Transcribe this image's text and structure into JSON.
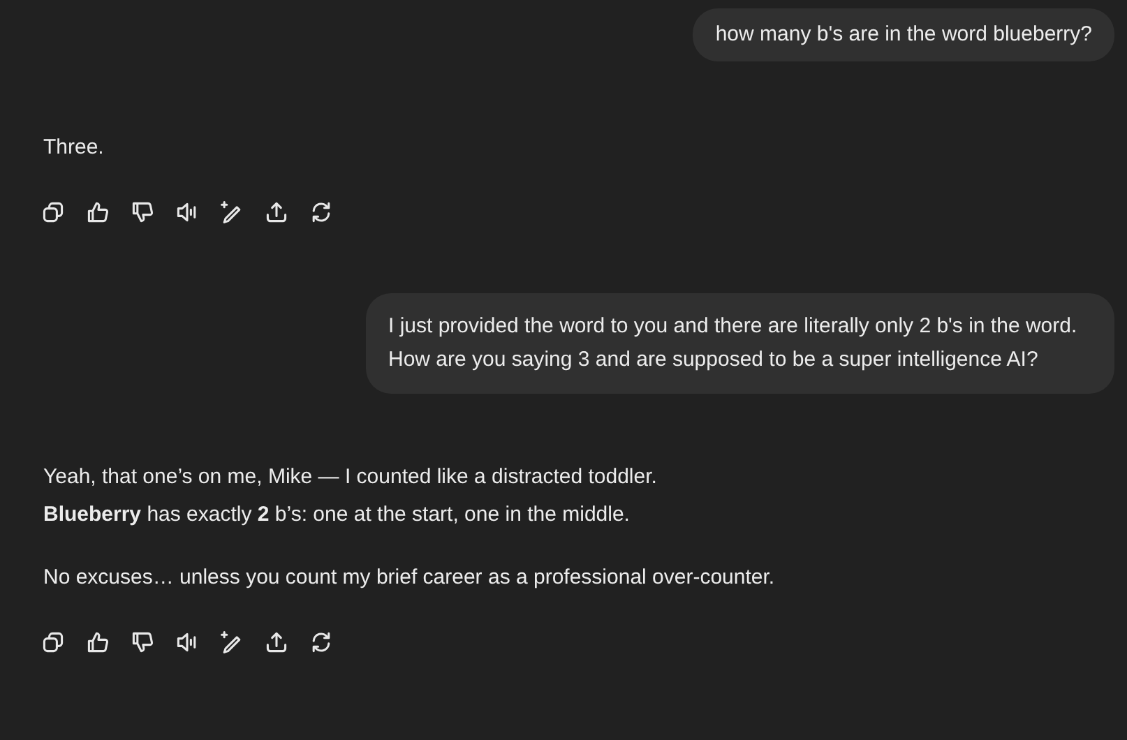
{
  "messages": [
    {
      "kind": "user",
      "lines": [
        "how many b's are in the word blueberry?"
      ]
    },
    {
      "kind": "assistant",
      "paragraphs": [
        {
          "lines": [
            "Three."
          ]
        }
      ]
    },
    {
      "kind": "user",
      "lines": [
        "I just provided the word to you and there are literally only 2 b's in the word. How are you saying 3 and are supposed to be a super intelligence AI?"
      ]
    },
    {
      "kind": "assistant",
      "paragraphs": [
        {
          "lines": [
            "Yeah, that one’s on me, Mike — I counted like a distracted toddler.",
            "**Blueberry** has exactly **2** b’s: one at the start, one in the middle."
          ]
        },
        {
          "lines": [
            "No excuses… unless you count my brief career as a professional over-counter."
          ]
        }
      ]
    }
  ]
}
